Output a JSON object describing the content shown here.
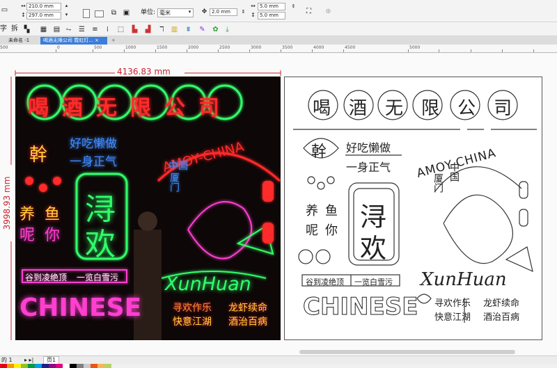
{
  "property_bar": {
    "width": "210.0 mm",
    "height": "297.0 mm",
    "units_label": "单位:",
    "units_value": "毫米",
    "nudge": "2.0 mm",
    "dup_x": "5.0 mm",
    "dup_y": "5.0 mm"
  },
  "toolbar2": {
    "text_tool": "字",
    "split_tool": "拆"
  },
  "tabs": [
    {
      "label": "未命名 -1"
    },
    {
      "label": "喝酒无限公司 霓虹灯...",
      "close": "×"
    }
  ],
  "tab_add": "+",
  "ruler_ticks": [
    "500",
    "0",
    "500",
    "1000",
    "1500",
    "2000",
    "2500",
    "3000",
    "3500",
    "4000",
    "4500",
    "5000"
  ],
  "dimensions": {
    "width": "4136.83 mm",
    "height": "3998.93 mm"
  },
  "design": {
    "title_chars": [
      "喝",
      "酒",
      "无",
      "限",
      "公",
      "司"
    ],
    "sign_gan": "幹",
    "slogan1": "好吃懒做",
    "slogan2": "一身正气",
    "amoy": "AMOY-CHINA",
    "zhongguo": "中国",
    "xiamen": "厦门",
    "xun": "浔",
    "huan": "欢",
    "yangyu": "养鱼",
    "nini": "呢你",
    "xunhuan": "XunHuan",
    "banner_left": "谷到凌绝顶",
    "banner_right": "一览白雪污",
    "chinese": "CHINESE",
    "bl1": "寻欢作乐",
    "bl2": "快意江湖",
    "br1": "龙虾续命",
    "br2": "酒治百病"
  },
  "status": {
    "page_info": "的 1",
    "page_tab": "页1"
  },
  "palette": [
    "#e60012",
    "#f39800",
    "#fff100",
    "#8fc31f",
    "#009944",
    "#00a0e9",
    "#1d2088",
    "#920783",
    "#e4007f",
    "#ffffff",
    "#000000",
    "#7f7f7f",
    "#c9caca",
    "#ea5514",
    "#f8b551",
    "#b3d465"
  ],
  "colors": {
    "neon_red": "#ff2a2a",
    "neon_green": "#30ff6a",
    "neon_pink": "#ff3fd0",
    "neon_blue": "#3f8cff",
    "neon_yellow": "#ffd23a",
    "dim_red": "#c8232c"
  }
}
